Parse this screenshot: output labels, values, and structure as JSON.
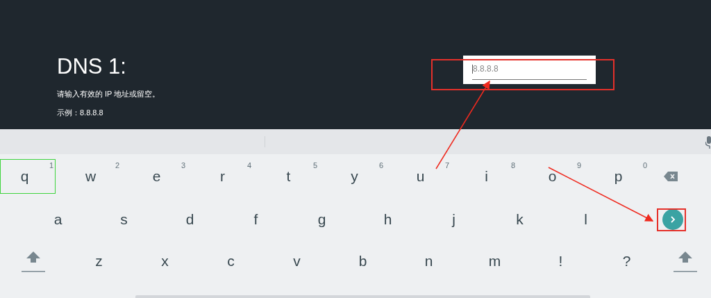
{
  "setting": {
    "title": "DNS 1:",
    "hint": "请输入有效的 IP 地址或留空。",
    "example": "示例：8.8.8.8"
  },
  "field": {
    "placeholder": "8.8.8.8"
  },
  "keyboard": {
    "rows": [
      [
        {
          "kind": "letter",
          "label": "q",
          "number": "1",
          "selected": true
        },
        {
          "kind": "letter",
          "label": "w",
          "number": "2",
          "selected": false
        },
        {
          "kind": "letter",
          "label": "e",
          "number": "3",
          "selected": false
        },
        {
          "kind": "letter",
          "label": "r",
          "number": "4",
          "selected": false
        },
        {
          "kind": "letter",
          "label": "t",
          "number": "5",
          "selected": false
        },
        {
          "kind": "letter",
          "label": "y",
          "number": "6",
          "selected": false
        },
        {
          "kind": "letter",
          "label": "u",
          "number": "7",
          "selected": false
        },
        {
          "kind": "letter",
          "label": "i",
          "number": "8",
          "selected": false
        },
        {
          "kind": "letter",
          "label": "o",
          "number": "9",
          "selected": false
        },
        {
          "kind": "letter",
          "label": "p",
          "number": "0",
          "selected": false
        },
        {
          "kind": "backspace"
        }
      ],
      [
        {
          "kind": "letter",
          "label": "a",
          "selected": false
        },
        {
          "kind": "letter",
          "label": "s",
          "selected": false
        },
        {
          "kind": "letter",
          "label": "d",
          "selected": false
        },
        {
          "kind": "letter",
          "label": "f",
          "selected": false
        },
        {
          "kind": "letter",
          "label": "g",
          "selected": false
        },
        {
          "kind": "letter",
          "label": "h",
          "selected": false
        },
        {
          "kind": "letter",
          "label": "j",
          "selected": false
        },
        {
          "kind": "letter",
          "label": "k",
          "selected": false
        },
        {
          "kind": "letter",
          "label": "l",
          "selected": false
        },
        {
          "kind": "enter"
        }
      ],
      [
        {
          "kind": "shift"
        },
        {
          "kind": "letter",
          "label": "z",
          "selected": false
        },
        {
          "kind": "letter",
          "label": "x",
          "selected": false
        },
        {
          "kind": "letter",
          "label": "c",
          "selected": false
        },
        {
          "kind": "letter",
          "label": "v",
          "selected": false
        },
        {
          "kind": "letter",
          "label": "b",
          "selected": false
        },
        {
          "kind": "letter",
          "label": "n",
          "selected": false
        },
        {
          "kind": "letter",
          "label": "m",
          "selected": false
        },
        {
          "kind": "letter",
          "label": "!",
          "selected": false
        },
        {
          "kind": "letter",
          "label": "?",
          "selected": false
        },
        {
          "kind": "shift"
        }
      ],
      [
        {
          "kind": "space"
        }
      ]
    ]
  }
}
